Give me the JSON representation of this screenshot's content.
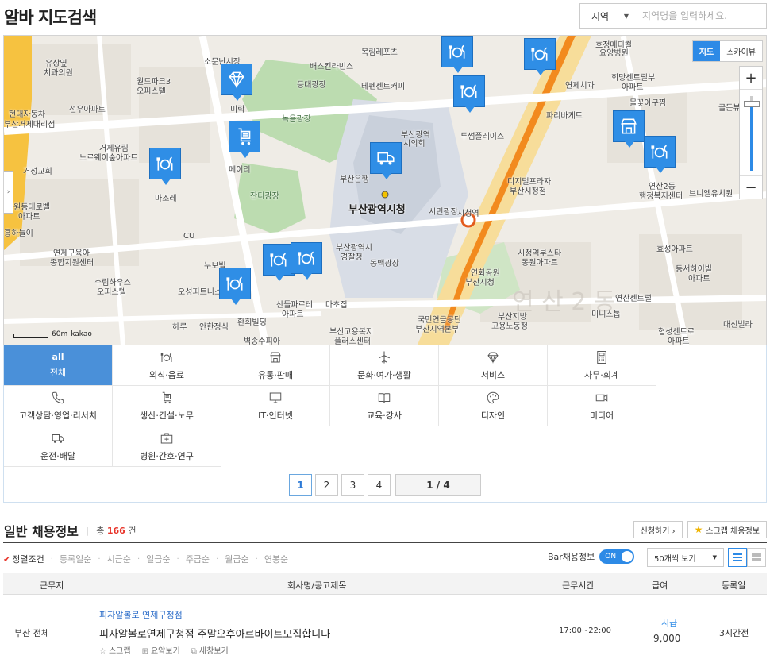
{
  "header": {
    "title": "알바 지도검색",
    "region_select": "지역",
    "region_placeholder": "지역명을 입력하세요."
  },
  "map": {
    "type_buttons": [
      "지도",
      "스카이뷰"
    ],
    "active_type": "지도",
    "zoom_in": "+",
    "zoom_out": "−",
    "scale_text": "60m",
    "provider": "kakao",
    "labels": [
      "유상옆",
      "치과의원",
      "소문난시장",
      "배스킨라빈스",
      "목림레포츠",
      "호정메디컬",
      "요양병원",
      "월드파크3",
      "오피스텔",
      "등대광장",
      "테펜센트커피",
      "연제치과",
      "희망센트럴부",
      "아파트",
      "현대자동차",
      "부산거제대리점",
      "선우아파트",
      "미락",
      "녹음광장",
      "부산광역",
      "시의회",
      "파리바게트",
      "물꽃아구찜",
      "골든뷰",
      "거제유림",
      "노르웨이숲아파트",
      "메이리",
      "투썸플레이스",
      "거성교회",
      "마조레",
      "부산은행",
      "디지털프라자",
      "부산시청점",
      "연산2동",
      "행정복지센터",
      "브니엘유치원",
      "원동대로벨",
      "아파트",
      "잔디광장",
      "부산광역시청",
      "시민광장",
      "시청역",
      "흥하늘이",
      "CU",
      "부산광역시",
      "경찰청",
      "효성아파트",
      "연제구육아",
      "종합지원센터",
      "누보빌",
      "동백광장",
      "시청역부스타",
      "동원아파트",
      "동서하이빌",
      "아파트",
      "수림하우스",
      "오피스텔",
      "오성피트니스",
      "산들파르테",
      "아파트",
      "연화공원",
      "부산시청",
      "연산2동",
      "연산센트럴",
      "하루",
      "안한정식",
      "환희빌딩",
      "마초집",
      "국민연금공단",
      "부산지역본부",
      "부산지방",
      "고용노동청",
      "미니스톱",
      "대신빌라",
      "벽송수피아",
      "부산고용복지",
      "플러스센터",
      "협성센트로",
      "아파트",
      "대"
    ],
    "main_label": "부산광역시청",
    "markers": [
      "restaurant-icon",
      "restaurant-icon",
      "restaurant-icon",
      "diamond-icon",
      "cart-icon",
      "restaurant-icon",
      "truck-icon",
      "shop-icon",
      "restaurant-icon",
      "restaurant-icon",
      "restaurant-icon",
      "restaurant-icon"
    ]
  },
  "categories": [
    {
      "label": "전체",
      "icon_text": "all",
      "active": true
    },
    {
      "label": "외식·음료",
      "icon": "restaurant-icon"
    },
    {
      "label": "유통·판매",
      "icon": "shop-icon"
    },
    {
      "label": "문화·여가·생활",
      "icon": "airplane-icon"
    },
    {
      "label": "서비스",
      "icon": "diamond-icon"
    },
    {
      "label": "사무·회계",
      "icon": "calculator-icon"
    },
    {
      "label": "고객상담·영업·리서치",
      "icon": "phone-icon"
    },
    {
      "label": "생산·건설·노무",
      "icon": "cart-icon"
    },
    {
      "label": "IT·인터넷",
      "icon": "monitor-icon"
    },
    {
      "label": "교육·강사",
      "icon": "book-icon"
    },
    {
      "label": "디자인",
      "icon": "palette-icon"
    },
    {
      "label": "미디어",
      "icon": "camera-icon"
    },
    {
      "label": "운전·배달",
      "icon": "truck-icon"
    },
    {
      "label": "병원·간호·연구",
      "icon": "medkit-icon"
    }
  ],
  "pager": {
    "pages": [
      "1",
      "2",
      "3",
      "4"
    ],
    "active": "1",
    "counter": "1 / 4"
  },
  "jobs": {
    "title": "일반 채용정보",
    "count_prefix": "총",
    "count": "166",
    "count_suffix": "건",
    "apply_button": "신청하기 ›",
    "scrap_button": "스크랩 채용정보",
    "sort_options": [
      "정렬조건",
      "등록일순",
      "시급순",
      "일급순",
      "주급순",
      "월급순",
      "연봉순"
    ],
    "bar_label": "Bar채용정보",
    "toggle_label": "ON",
    "per_page": "50개씩 보기",
    "columns": [
      "근무지",
      "회사명/공고제목",
      "근무시간",
      "급여",
      "등록일"
    ],
    "rows": [
      {
        "location": "부산 전체",
        "company": "피자알볼로 연제구청점",
        "title": "피자알볼로연제구청점 주말오후아르바이트모집합니다",
        "tools": [
          "스크랩",
          "요약보기",
          "새창보기"
        ],
        "time": "17:00~22:00",
        "pay_type": "시급",
        "pay": "9,000",
        "posted": "3시간전"
      }
    ]
  }
}
